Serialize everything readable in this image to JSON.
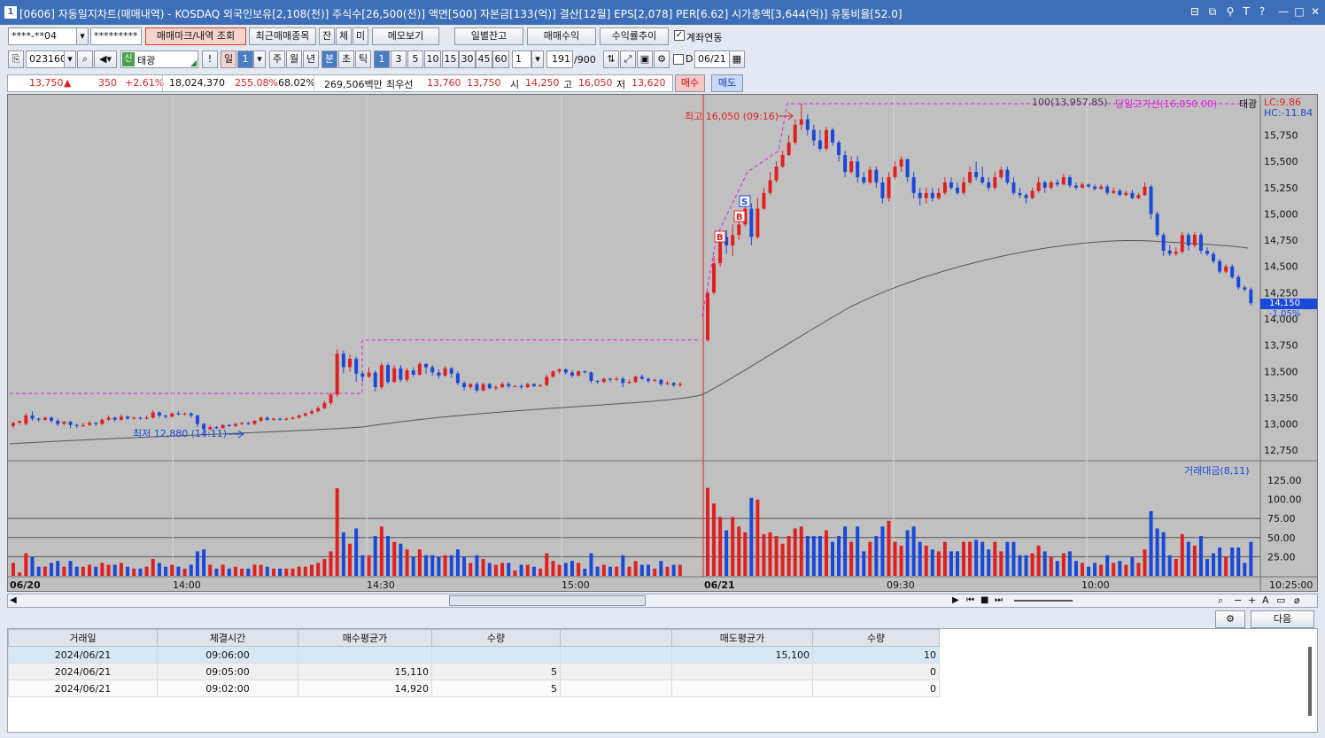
{
  "title": {
    "text": "[0606] 자동일지차트(매매내역) - KOSDAQ 외국인보유[2,108(천)] 주식수[26,500(천)] 액면[500] 자본금[133(억)] 결산[12월] EPS[2,078] PER[6.62] 시가총액[3,644(억)] 유통비율[52.0]",
    "icon": "1"
  },
  "toolbar1": {
    "account": "****-**04",
    "password": "*********",
    "mark_btn": "매매마크/내역 조회",
    "recent_btn": "최근매매종목",
    "jan": "잔",
    "che": "체",
    "mi": "미",
    "memo_btn": "메모보기",
    "daily_btn": "일별잔고",
    "profit_btn": "매매수익",
    "yield_btn": "수익률추이",
    "link_label": "계좌연동"
  },
  "toolbar2": {
    "code": "023160",
    "credit": "신",
    "name": "태광",
    "excl": "!",
    "periods": [
      "일",
      "주",
      "월",
      "년",
      "분",
      "초",
      "틱"
    ],
    "period_num": "1",
    "minutes": [
      "1",
      "3",
      "5",
      "10",
      "15",
      "30",
      "45",
      "60"
    ],
    "count_sel": "1",
    "count": "191",
    "count_max": "/900",
    "d_label": "D",
    "date": "06/21"
  },
  "quote": {
    "price": "13,750",
    "arrow": "▲",
    "change": "350",
    "rate": "+2.61%",
    "volume": "18,024,370",
    "turnover": "255.08%",
    "ratio": "68.02%",
    "amount": "269,506백만",
    "best_label": "최우선",
    "best_ask": "13,760",
    "best_bid": "13,750",
    "open_label": "시",
    "open": "14,250",
    "high_label": "고",
    "high": "16,050",
    "low_label": "저",
    "low": "13,620",
    "buy_btn": "매수",
    "sell_btn": "매도"
  },
  "chart_labels": {
    "ma": "100(13,957.85)",
    "high_line": "당일고가선(16,050.00)",
    "stock": "태광",
    "lc": "LC:9.86",
    "hc": "HC:-11.84",
    "high_note": "최고 16,050 (09:16)",
    "low_note": "최저 12,880 (14:11)",
    "cur_price": "14,150",
    "cur_rate": "-1.05%",
    "vol_legend": "거래대금(8,11)",
    "marker_b": "B",
    "marker_s": "S"
  },
  "colors": {
    "up": "#e02020",
    "down": "#1a48d8",
    "bg": "#c0c0c0",
    "ma": "#555555",
    "highline": "#e020e0"
  },
  "chart_data": {
    "type": "candlestick",
    "y_ticks": [
      "15,750",
      "15,500",
      "15,250",
      "15,000",
      "14,750",
      "14,500",
      "14,250",
      "14,000",
      "13,750",
      "13,500",
      "13,250",
      "13,000",
      "12,750"
    ],
    "vol_ticks": [
      "125.00",
      "100.00",
      "75.00",
      "50.00",
      "25.00"
    ],
    "x_ticks": [
      "06/20",
      "14:00",
      "14:30",
      "15:00",
      "06/21",
      "09:30",
      "10:00",
      "10:25:00"
    ],
    "ylim": [
      12650,
      16050
    ],
    "session1_candles": [
      [
        12980,
        13010,
        12960,
        13020
      ],
      [
        13010,
        13030,
        12990,
        13000
      ],
      [
        13000,
        13080,
        12990,
        13100
      ],
      [
        13080,
        13050,
        13030,
        13120
      ],
      [
        13050,
        13040,
        13020,
        13060
      ],
      [
        13040,
        13060,
        13030,
        13070
      ],
      [
        13060,
        13030,
        13010,
        13070
      ],
      [
        13030,
        13000,
        12980,
        13050
      ],
      [
        13000,
        13020,
        12990,
        13030
      ],
      [
        13020,
        12990,
        12960,
        13030
      ],
      [
        12990,
        12980,
        12960,
        13000
      ],
      [
        12980,
        12990,
        12970,
        13010
      ],
      [
        12990,
        13010,
        12980,
        13030
      ],
      [
        13010,
        13000,
        12980,
        13020
      ],
      [
        13000,
        13040,
        12990,
        13050
      ],
      [
        13040,
        13060,
        13030,
        13080
      ],
      [
        13060,
        13040,
        13020,
        13070
      ],
      [
        13040,
        13070,
        13030,
        13090
      ],
      [
        13070,
        13050,
        13040,
        13080
      ],
      [
        13050,
        13060,
        13040,
        13070
      ],
      [
        13060,
        13050,
        13040,
        13070
      ],
      [
        13050,
        13060,
        13040,
        13080
      ],
      [
        13060,
        13110,
        13050,
        13130
      ],
      [
        13110,
        13080,
        13060,
        13120
      ],
      [
        13080,
        13070,
        13050,
        13090
      ],
      [
        13070,
        13100,
        13060,
        13110
      ],
      [
        13100,
        13090,
        13080,
        13120
      ],
      [
        13090,
        13100,
        13080,
        13110
      ],
      [
        13100,
        13080,
        13060,
        13110
      ],
      [
        13080,
        13000,
        12970,
        13090
      ],
      [
        13000,
        12950,
        12880,
        13010
      ],
      [
        12950,
        12970,
        12940,
        12990
      ],
      [
        12970,
        12960,
        12950,
        12980
      ],
      [
        12960,
        12990,
        12950,
        13000
      ],
      [
        12990,
        12980,
        12970,
        13000
      ],
      [
        12980,
        13000,
        12970,
        13010
      ],
      [
        13000,
        13010,
        12990,
        13020
      ],
      [
        13010,
        13000,
        12990,
        13020
      ],
      [
        13000,
        13030,
        12990,
        13040
      ],
      [
        13030,
        13060,
        13020,
        13070
      ],
      [
        13060,
        13040,
        13030,
        13070
      ],
      [
        13040,
        13050,
        13030,
        13060
      ],
      [
        13050,
        13040,
        13030,
        13060
      ],
      [
        13040,
        13050,
        13030,
        13060
      ],
      [
        13050,
        13060,
        13040,
        13070
      ],
      [
        13060,
        13080,
        13050,
        13090
      ],
      [
        13080,
        13100,
        13070,
        13110
      ],
      [
        13100,
        13120,
        13090,
        13140
      ],
      [
        13120,
        13150,
        13110,
        13170
      ],
      [
        13150,
        13200,
        13140,
        13220
      ],
      [
        13200,
        13280,
        13180,
        13300
      ],
      [
        13280,
        13670,
        13260,
        13710
      ],
      [
        13670,
        13540,
        13480,
        13700
      ],
      [
        13540,
        13620,
        13500,
        13660
      ],
      [
        13620,
        13480,
        13400,
        13640
      ],
      [
        13480,
        13450,
        13400,
        13500
      ],
      [
        13450,
        13490,
        13440,
        13540
      ],
      [
        13490,
        13350,
        13310,
        13510
      ],
      [
        13350,
        13560,
        13330,
        13580
      ],
      [
        13560,
        13400,
        13380,
        13580
      ],
      [
        13400,
        13530,
        13390,
        13560
      ],
      [
        13530,
        13420,
        13400,
        13560
      ],
      [
        13420,
        13510,
        13400,
        13530
      ],
      [
        13510,
        13470,
        13450,
        13540
      ],
      [
        13470,
        13570,
        13460,
        13590
      ],
      [
        13570,
        13540,
        13480,
        13580
      ],
      [
        13540,
        13490,
        13460,
        13560
      ],
      [
        13490,
        13460,
        13430,
        13520
      ],
      [
        13460,
        13530,
        13450,
        13550
      ],
      [
        13530,
        13480,
        13440,
        13540
      ],
      [
        13480,
        13390,
        13370,
        13500
      ],
      [
        13390,
        13350,
        13320,
        13410
      ],
      [
        13350,
        13380,
        13330,
        13390
      ],
      [
        13380,
        13320,
        13300,
        13400
      ],
      [
        13320,
        13380,
        13310,
        13390
      ],
      [
        13380,
        13340,
        13330,
        13390
      ],
      [
        13340,
        13350,
        13320,
        13370
      ],
      [
        13350,
        13380,
        13340,
        13400
      ],
      [
        13380,
        13360,
        13340,
        13400
      ],
      [
        13360,
        13360,
        13350,
        13370
      ],
      [
        13360,
        13350,
        13330,
        13380
      ],
      [
        13350,
        13380,
        13340,
        13390
      ],
      [
        13380,
        13360,
        13350,
        13390
      ],
      [
        13360,
        13370,
        13350,
        13380
      ],
      [
        13370,
        13450,
        13360,
        13470
      ],
      [
        13450,
        13500,
        13440,
        13510
      ],
      [
        13500,
        13520,
        13480,
        13530
      ],
      [
        13520,
        13490,
        13470,
        13530
      ],
      [
        13490,
        13460,
        13440,
        13510
      ],
      [
        13460,
        13500,
        13450,
        13510
      ],
      [
        13500,
        13490,
        13480,
        13510
      ],
      [
        13490,
        13410,
        13390,
        13500
      ],
      [
        13410,
        13400,
        13380,
        13420
      ],
      [
        13400,
        13430,
        13390,
        13440
      ],
      [
        13430,
        13420,
        13400,
        13440
      ],
      [
        13420,
        13430,
        13410,
        13450
      ],
      [
        13430,
        13390,
        13350,
        13450
      ],
      [
        13390,
        13400,
        13380,
        13420
      ],
      [
        13400,
        13450,
        13390,
        13460
      ],
      [
        13450,
        13430,
        13420,
        13470
      ],
      [
        13430,
        13410,
        13390,
        13440
      ],
      [
        13410,
        13420,
        13400,
        13430
      ],
      [
        13420,
        13380,
        13360,
        13430
      ],
      [
        13380,
        13390,
        13370,
        13410
      ],
      [
        13390,
        13370,
        13350,
        13400
      ],
      [
        13370,
        13380,
        13350,
        13400
      ]
    ],
    "session2_candles": [
      [
        13800,
        14250,
        13780,
        14260
      ],
      [
        14250,
        14530,
        14230,
        14600
      ],
      [
        14530,
        14780,
        14500,
        14800
      ],
      [
        14780,
        14700,
        14620,
        14850
      ],
      [
        14700,
        14800,
        14600,
        14900
      ],
      [
        14800,
        14900,
        14750,
        15000
      ],
      [
        14900,
        15050,
        14880,
        15100
      ],
      [
        15050,
        14780,
        14700,
        15100
      ],
      [
        14780,
        15050,
        14760,
        15150
      ],
      [
        15050,
        15200,
        15040,
        15250
      ],
      [
        15200,
        15320,
        15180,
        15400
      ],
      [
        15320,
        15450,
        15300,
        15500
      ],
      [
        15450,
        15560,
        15440,
        15600
      ],
      [
        15560,
        15680,
        15550,
        15750
      ],
      [
        15680,
        15850,
        15660,
        15900
      ],
      [
        15850,
        15900,
        15800,
        16050
      ],
      [
        15900,
        15800,
        15750,
        15950
      ],
      [
        15800,
        15700,
        15650,
        15850
      ],
      [
        15700,
        15620,
        15600,
        15800
      ],
      [
        15620,
        15800,
        15600,
        15830
      ],
      [
        15800,
        15680,
        15650,
        15820
      ],
      [
        15680,
        15560,
        15500,
        15700
      ],
      [
        15560,
        15400,
        15350,
        15600
      ],
      [
        15400,
        15500,
        15380,
        15550
      ],
      [
        15500,
        15350,
        15300,
        15550
      ],
      [
        15350,
        15300,
        15280,
        15400
      ],
      [
        15300,
        15420,
        15280,
        15450
      ],
      [
        15420,
        15300,
        15250,
        15450
      ],
      [
        15300,
        15150,
        15100,
        15350
      ],
      [
        15150,
        15350,
        15120,
        15400
      ],
      [
        15350,
        15450,
        15330,
        15500
      ],
      [
        15450,
        15520,
        15400,
        15550
      ],
      [
        15520,
        15350,
        15300,
        15530
      ],
      [
        15350,
        15200,
        15150,
        15400
      ],
      [
        15200,
        15150,
        15080,
        15250
      ],
      [
        15150,
        15200,
        15100,
        15250
      ],
      [
        15200,
        15150,
        15120,
        15250
      ],
      [
        15150,
        15200,
        15130,
        15250
      ],
      [
        15200,
        15300,
        15180,
        15350
      ],
      [
        15300,
        15250,
        15230,
        15350
      ],
      [
        15250,
        15200,
        15180,
        15300
      ],
      [
        15200,
        15300,
        15180,
        15350
      ],
      [
        15300,
        15400,
        15280,
        15450
      ],
      [
        15400,
        15350,
        15320,
        15500
      ],
      [
        15350,
        15300,
        15280,
        15450
      ],
      [
        15300,
        15250,
        15220,
        15350
      ],
      [
        15250,
        15350,
        15230,
        15400
      ],
      [
        15350,
        15420,
        15330,
        15450
      ],
      [
        15420,
        15300,
        15280,
        15450
      ],
      [
        15300,
        15200,
        15180,
        15350
      ],
      [
        15200,
        15180,
        15150,
        15250
      ],
      [
        15180,
        15150,
        15100,
        15200
      ],
      [
        15150,
        15220,
        15140,
        15250
      ],
      [
        15220,
        15300,
        15200,
        15350
      ],
      [
        15300,
        15250,
        15200,
        15320
      ],
      [
        15250,
        15300,
        15230,
        15320
      ],
      [
        15300,
        15280,
        15260,
        15330
      ],
      [
        15280,
        15350,
        15270,
        15380
      ],
      [
        15350,
        15270,
        15250,
        15370
      ],
      [
        15270,
        15250,
        15230,
        15300
      ],
      [
        15250,
        15280,
        15240,
        15300
      ],
      [
        15280,
        15260,
        15250,
        15290
      ],
      [
        15260,
        15240,
        15220,
        15280
      ],
      [
        15240,
        15260,
        15230,
        15280
      ],
      [
        15260,
        15200,
        15180,
        15280
      ],
      [
        15200,
        15220,
        15190,
        15250
      ],
      [
        15220,
        15180,
        15170,
        15240
      ],
      [
        15180,
        15200,
        15170,
        15220
      ],
      [
        15200,
        15150,
        15140,
        15230
      ],
      [
        15150,
        15180,
        15140,
        15200
      ],
      [
        15180,
        15260,
        15170,
        15300
      ],
      [
        15260,
        15000,
        14950,
        15280
      ],
      [
        15000,
        14800,
        14780,
        15020
      ],
      [
        14800,
        14650,
        14600,
        14820
      ],
      [
        14650,
        14620,
        14600,
        14700
      ],
      [
        14620,
        14640,
        14600,
        14680
      ],
      [
        14640,
        14800,
        14620,
        14830
      ],
      [
        14800,
        14700,
        14650,
        14820
      ],
      [
        14700,
        14800,
        14680,
        14830
      ],
      [
        14800,
        14650,
        14620,
        14820
      ],
      [
        14650,
        14620,
        14600,
        14680
      ],
      [
        14620,
        14550,
        14530,
        14640
      ],
      [
        14550,
        14450,
        14430,
        14570
      ],
      [
        14450,
        14500,
        14430,
        14520
      ],
      [
        14500,
        14400,
        14380,
        14520
      ],
      [
        14400,
        14300,
        14280,
        14420
      ],
      [
        14300,
        14280,
        14260,
        14320
      ],
      [
        14280,
        14150,
        14130,
        14300
      ]
    ],
    "high_line": 16050,
    "prev_high_line": 13800,
    "prev_high_line_early": 13290
  },
  "grid": {
    "headers": [
      "거래일",
      "체결시간",
      "매수평균가",
      "수량",
      "",
      "매도평균가",
      "수량"
    ],
    "rows": [
      [
        "2024/06/21",
        "09:06:00",
        "",
        "",
        "",
        "15,100",
        "10"
      ],
      [
        "2024/06/21",
        "09:05:00",
        "15,110",
        "5",
        "",
        "",
        "0"
      ],
      [
        "2024/06/21",
        "09:02:00",
        "14,920",
        "5",
        "",
        "",
        "0"
      ]
    ],
    "next_btn": "다음"
  }
}
